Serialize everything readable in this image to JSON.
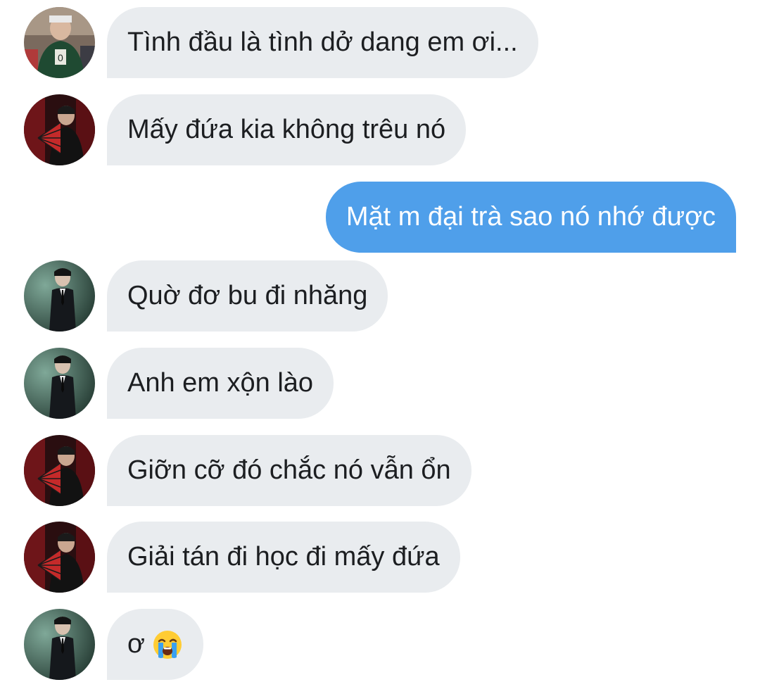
{
  "colors": {
    "incoming_bubble": "#e9ecef",
    "outgoing_bubble": "#4f9fea",
    "incoming_text": "#1c1e21",
    "outgoing_text": "#ffffff"
  },
  "messages": [
    {
      "sender": "user-a",
      "direction": "incoming",
      "text": "Tình đầu là tình dở dang em ơi..."
    },
    {
      "sender": "user-b",
      "direction": "incoming",
      "text": "Mấy đứa kia không trêu nó"
    },
    {
      "sender": "me",
      "direction": "outgoing",
      "text": "Mặt m đại trà sao nó nhớ được"
    },
    {
      "sender": "user-c",
      "direction": "incoming",
      "text": "Quờ đơ bu đi nhăng"
    },
    {
      "sender": "user-c",
      "direction": "incoming",
      "text": "Anh em xộn lào"
    },
    {
      "sender": "user-b",
      "direction": "incoming",
      "text": "Giỡn cỡ đó chắc nó vẫn ổn"
    },
    {
      "sender": "user-b",
      "direction": "incoming",
      "text": "Giải tán đi học đi mấy đứa"
    },
    {
      "sender": "user-c",
      "direction": "incoming",
      "text": "ơ",
      "emoji": "loudly-crying-face-emoji"
    }
  ]
}
